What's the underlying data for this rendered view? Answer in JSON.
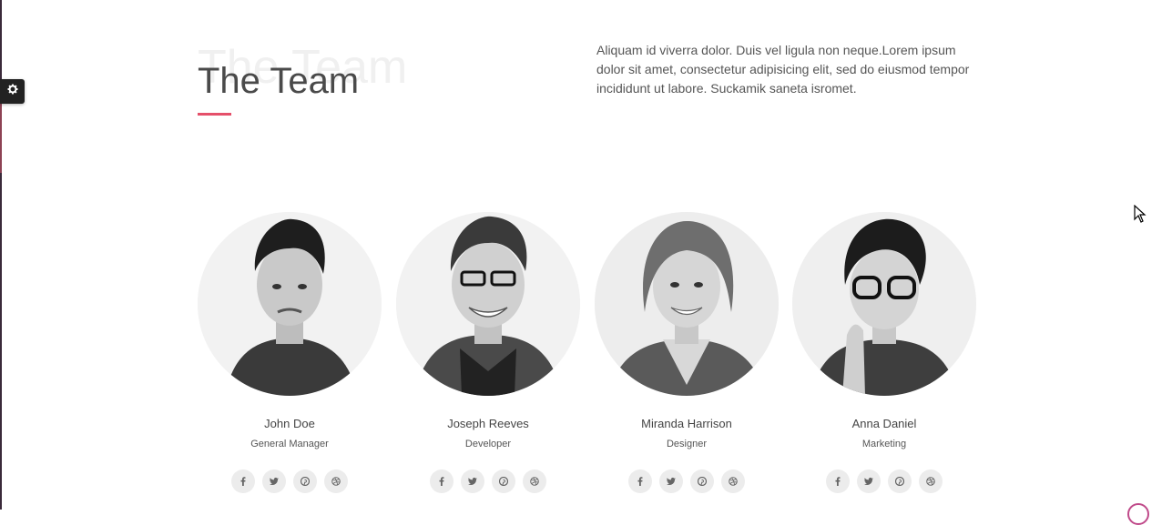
{
  "section": {
    "title_ghost": "The Team",
    "title": "The Team",
    "intro": "Aliquam id viverra dolor. Duis vel ligula non neque.Lorem ipsum dolor sit amet, consectetur adipisicing elit, sed do eiusmod tempor incididunt ut labore. Suckamik saneta isromet."
  },
  "settings": {
    "icon": "gear-icon"
  },
  "members": [
    {
      "name": "John Doe",
      "role": "General Manager"
    },
    {
      "name": "Joseph Reeves",
      "role": "Developer"
    },
    {
      "name": "Miranda Harrison",
      "role": "Designer"
    },
    {
      "name": "Anna Daniel",
      "role": "Marketing"
    }
  ],
  "social_icons": [
    "facebook-icon",
    "twitter-icon",
    "pinterest-icon",
    "dribbble-icon"
  ],
  "colors": {
    "accent": "#e5506a",
    "heading": "#4a4a4a",
    "text": "#555555"
  }
}
